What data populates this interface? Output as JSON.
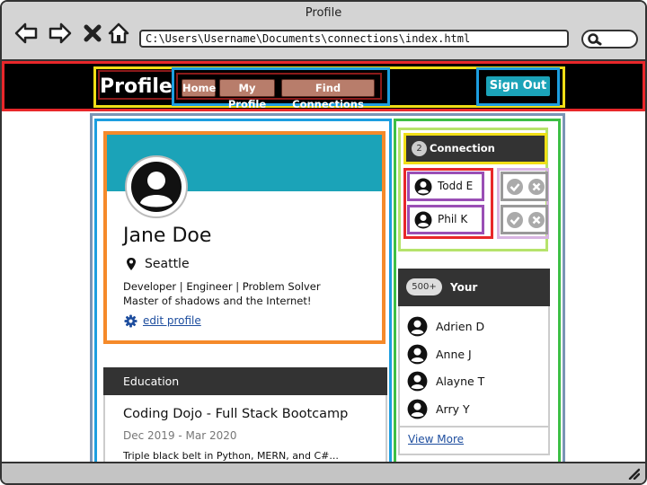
{
  "window": {
    "title": "Profile"
  },
  "browser": {
    "address": "C:\\Users\\Username\\Documents\\connections\\index.html"
  },
  "nav": {
    "brand": "Profile",
    "links": [
      "Home",
      "My Profile",
      "Find Connections"
    ],
    "sign_out": "Sign Out"
  },
  "profile": {
    "name": "Jane Doe",
    "location": "Seattle",
    "bio_line1": "Developer | Engineer | Problem Solver",
    "bio_line2": "Master of shadows and the Internet!",
    "edit_link": "edit profile"
  },
  "education": {
    "header": "Education",
    "school": "Coding Dojo - Full Stack Bootcamp",
    "dates": "Dec 2019 - Mar 2020",
    "description": "Triple black belt in Python, MERN, and C#..."
  },
  "requests": {
    "count": "2",
    "title": "Connection Requests",
    "items": [
      "Todd E",
      "Phil K"
    ]
  },
  "connections": {
    "count": "500+",
    "title": "Your Connections",
    "items": [
      "Adrien D",
      "Anne J",
      "Alayne T",
      "Arry Y"
    ],
    "view_more": "View More"
  },
  "colors": {
    "accent": "#1ba3b8",
    "navbar": "#000000",
    "nav_button": "#b87d6b",
    "link": "#1d4d9e"
  },
  "icons": {
    "back": "back-arrow-icon",
    "forward": "forward-arrow-icon",
    "stop": "close-icon",
    "home": "home-icon",
    "search": "search-icon",
    "location": "map-pin-icon",
    "settings": "gear-icon",
    "accept": "check-icon",
    "decline": "x-icon",
    "user": "user-avatar-icon"
  }
}
